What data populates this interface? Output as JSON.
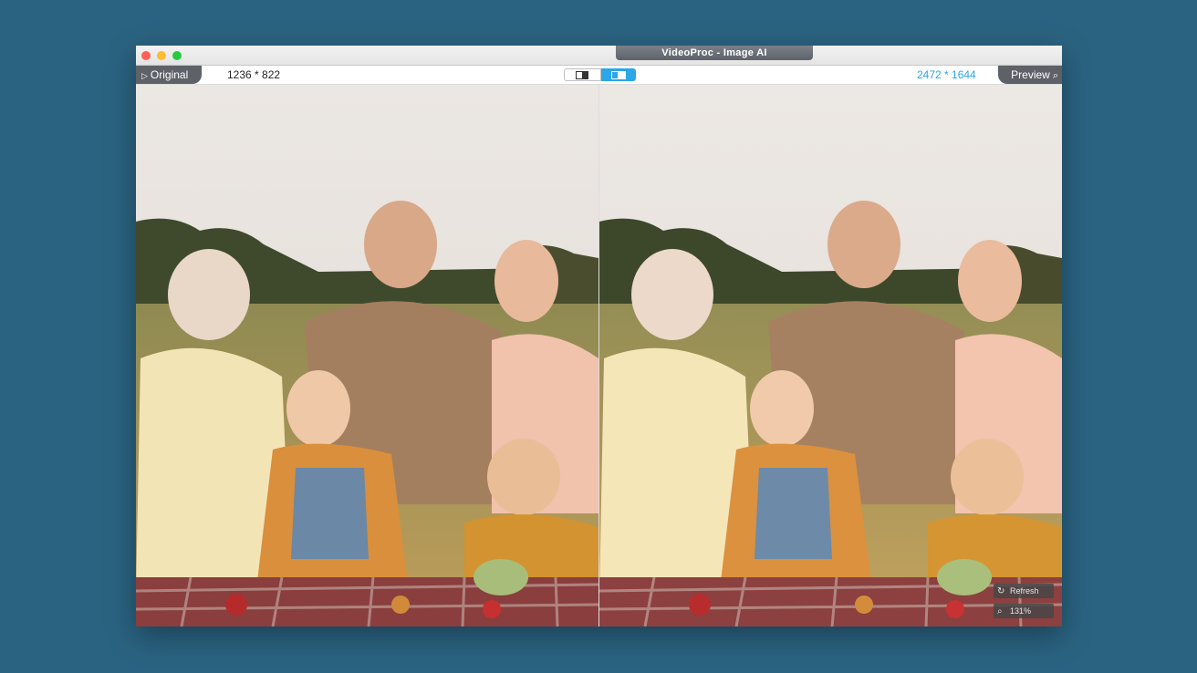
{
  "window": {
    "title": "VideoProc - Image AI"
  },
  "toolbar": {
    "original_label": "Original",
    "original_resolution": "1236 * 822",
    "preview_label": "Preview",
    "preview_resolution": "2472 * 1644",
    "view_modes": [
      "single-view",
      "split-view"
    ],
    "active_view_mode": "split-view"
  },
  "image": {
    "description_icon": "family-picnic-photo"
  },
  "overlay": {
    "refresh_label": "Refresh",
    "zoom_label": "131%"
  },
  "colors": {
    "accent": "#2ba6e6",
    "background": "#2a6381",
    "tab_dark": "#5e6168"
  }
}
